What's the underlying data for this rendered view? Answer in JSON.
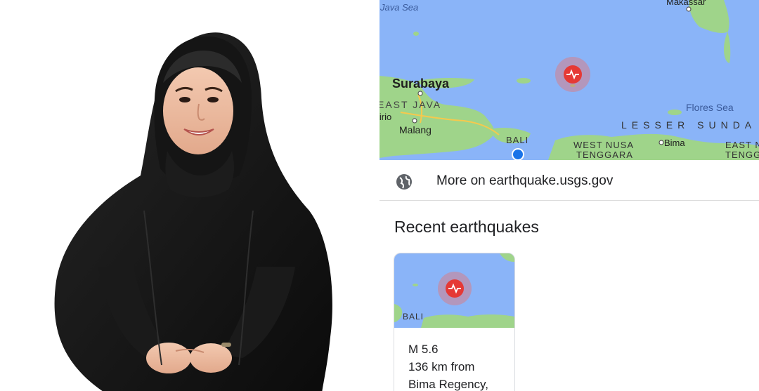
{
  "map": {
    "labels": {
      "java_sea": "Java Sea",
      "makassar": "Makassar",
      "surabaya": "Surabaya",
      "east_java": "EAST JAVA",
      "probolinggo_frag": "lirio",
      "malang": "Malang",
      "bali": "BALI",
      "flores_sea": "Flores Sea",
      "lesser_sunda": "LESSER SUNDA",
      "west_nusa": "WEST NUSA",
      "tenggara": "TENGGARA",
      "bima": "Bima",
      "east_n": "EAST N",
      "tengg": "TENGG"
    },
    "colors": {
      "sea": "#8ab4f8",
      "land": "#9fd48a",
      "marker": "#e53935"
    }
  },
  "source_link": {
    "icon": "globe-icon",
    "label": "More on earthquake.usgs.gov"
  },
  "recent": {
    "title": "Recent earthquakes",
    "card": {
      "map_label": "BALI",
      "magnitude": "M 5.6",
      "distance": "136 km from",
      "place": "Bima Regency,"
    }
  }
}
